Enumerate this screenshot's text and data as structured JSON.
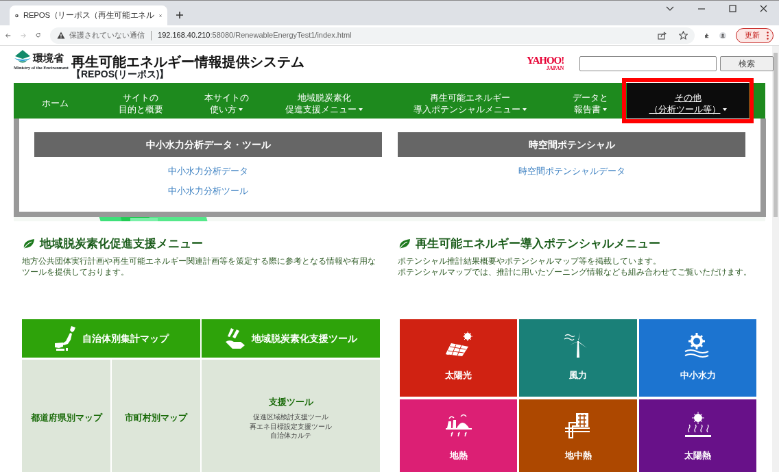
{
  "browser": {
    "tab_title": "REPOS（リーポス（再生可能エネル",
    "security_label": "保護されていない通信",
    "url_host": "192.168.40.210",
    "url_rest": ":58080/RenewableEnergyTest1/index.html",
    "update_button": "更新"
  },
  "header": {
    "ministry_name": "環境省",
    "ministry_name_en": "Ministry of the Environment",
    "title": "再生可能エネルギー情報提供システム",
    "subtitle": "【REPOS(リーポス)】",
    "yahoo_logo": "YAHOO!",
    "yahoo_sub": "JAPAN",
    "search_button": "検索"
  },
  "nav": [
    {
      "lines": [
        "ホーム"
      ],
      "has_menu": false,
      "selected": false
    },
    {
      "lines": [
        "サイトの",
        "目的と概要"
      ],
      "has_menu": false,
      "selected": false
    },
    {
      "lines": [
        "本サイトの",
        "使い方"
      ],
      "has_menu": true,
      "selected": false
    },
    {
      "lines": [
        "地域脱炭素化",
        "促進支援メニュー"
      ],
      "has_menu": true,
      "selected": false
    },
    {
      "lines": [
        "再生可能エネルギー",
        "導入ポテンシャルメニュー"
      ],
      "has_menu": true,
      "selected": false
    },
    {
      "lines": [
        "データと",
        "報告書"
      ],
      "has_menu": true,
      "selected": false
    },
    {
      "lines": [
        "その他",
        "（分析ツール等）"
      ],
      "has_menu": true,
      "selected": true
    }
  ],
  "dropdown": {
    "columns": [
      {
        "heading": "中小水力分析データ・ツール",
        "links": [
          "中小水力分析データ",
          "中小水力分析ツール"
        ]
      },
      {
        "heading": "時空間ポテンシャル",
        "links": [
          "時空間ポテンシャルデータ"
        ]
      }
    ]
  },
  "sections": [
    {
      "title": "地域脱炭素化促進支援メニュー",
      "lines": [
        "地方公共団体実行計画や再生可能エネルギー関連計画等を策定する際に参考となる情報や有用な",
        "ツールを提供しております。"
      ]
    },
    {
      "title": "再生可能エネルギー導入ポテンシャルメニュー",
      "lines": [
        "ポテンシャル推計結果概要やポテンシャルマップ等を掲載しています。",
        "ポテンシャルマップでは、推計に用いたゾーニング情報なども組み合わせてご覧いただけます。"
      ]
    }
  ],
  "tools": {
    "headers": [
      {
        "label": "自治体別集計マップ",
        "kind": "japan"
      },
      {
        "label": "地域脱炭素化支援ツール",
        "kind": "tools"
      }
    ],
    "maps": [
      "都道府県別マップ",
      "市町村別マップ"
    ],
    "support": {
      "title": "支援ツール",
      "items": [
        "促進区域検討支援ツール",
        "再エネ目標設定支援ツール",
        "自治体カルテ"
      ]
    }
  },
  "energy_tiles": [
    {
      "label": "太陽光",
      "kind": "solar",
      "color": "#d02212"
    },
    {
      "label": "風力",
      "kind": "wind",
      "color": "#1a8078"
    },
    {
      "label": "中小水力",
      "kind": "hydro",
      "color": "#1c74d0"
    },
    {
      "label": "地熱",
      "kind": "geothermal",
      "color": "#dc1f74"
    },
    {
      "label": "地中熱",
      "kind": "ground",
      "color": "#ad4800"
    },
    {
      "label": "太陽熱",
      "kind": "solarheat",
      "color": "#681189"
    }
  ]
}
